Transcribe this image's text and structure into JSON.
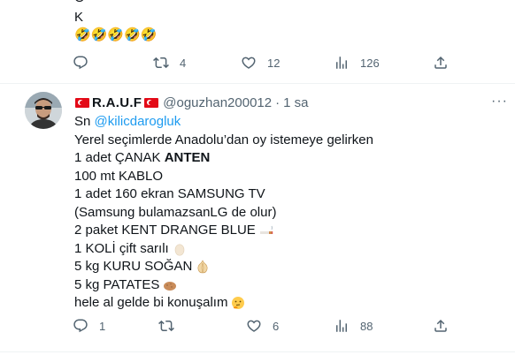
{
  "previous_tweet": {
    "line1": "O",
    "line2": "K",
    "line3": "🤣🤣🤣🤣🤣",
    "actions": {
      "replies": "",
      "retweets": "4",
      "likes": "12",
      "views": "126"
    }
  },
  "tweet": {
    "display_name": "R.A.U.F",
    "handle": "@oguzhan200012",
    "dot": "·",
    "time": "1 sa",
    "more_label": "···",
    "body": {
      "sn_prefix": "Sn ",
      "mention": "@kilicdarogluk",
      "line_intro": "Yerel seçimlerde Anadolu’dan oy istemeye gelirken",
      "line_canak_prefix": "1 adet ÇANAK ",
      "line_canak_bold": "ANTEN",
      "line_kablo": "100 mt KABLO",
      "line_tv": "1 adet 160 ekran SAMSUNG TV",
      "line_note": "(Samsung bulamazsanLG de olur)",
      "line_cig": "2 paket KENT DRANGE BLUE",
      "line_egg": "1 KOLİ çift sarılı",
      "line_onion": "5 kg KURU SOĞAN",
      "line_potato": "5 kg PATATES",
      "line_end": "hele al gelde bi konuşalım"
    },
    "actions": {
      "replies": "1",
      "retweets": "",
      "likes": "6",
      "views": "88"
    }
  },
  "colors": {
    "text": "#0f1419",
    "secondary": "#536471",
    "link": "#1d9bf0",
    "divider": "#eff3f4",
    "flag_red": "#e30a17"
  },
  "icons": [
    "reply-icon",
    "retweet-icon",
    "like-icon",
    "views-icon",
    "share-icon",
    "more-icon",
    "turkish-flag-icon",
    "cigarette-icon",
    "egg-icon",
    "onion-icon",
    "potato-icon",
    "thinking-face-icon"
  ]
}
